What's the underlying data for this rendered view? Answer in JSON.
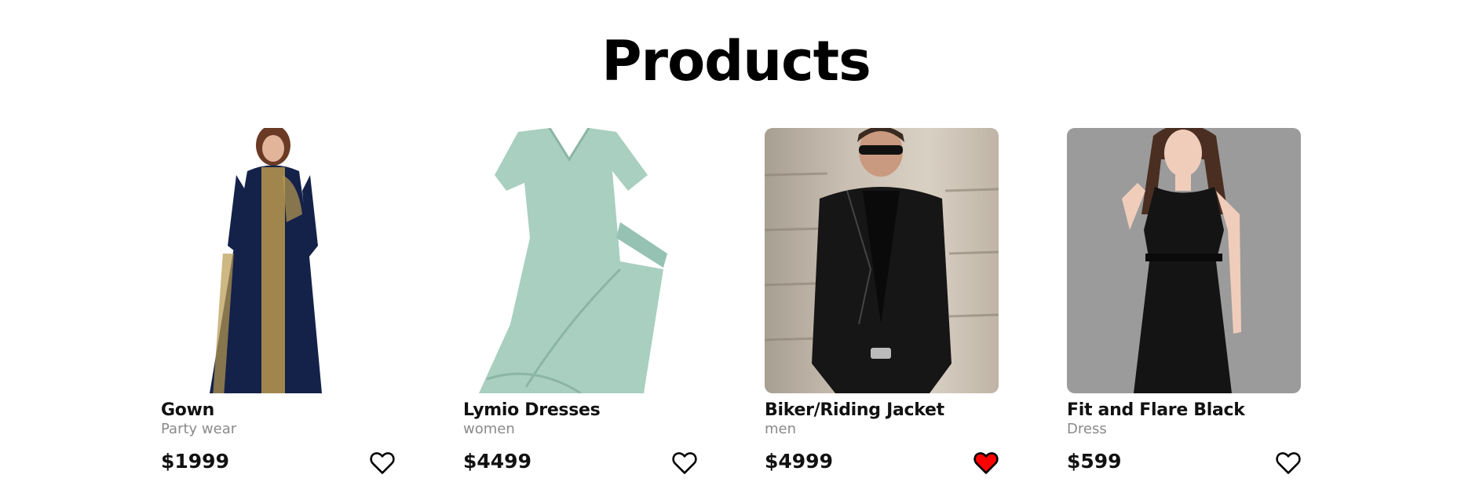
{
  "page": {
    "title": "Products"
  },
  "colors": {
    "favorite_active": "#ff0000",
    "category_text": "#8a8a8a"
  },
  "products": [
    {
      "name": "Gown",
      "category": "Party wear",
      "price": "$1999",
      "favorited": false,
      "image": "navy-gown-photo"
    },
    {
      "name": "Lymio Dresses",
      "category": "women",
      "price": "$4499",
      "favorited": false,
      "image": "mint-wrap-dress-photo"
    },
    {
      "name": "Biker/Riding Jacket",
      "category": "men",
      "price": "$4999",
      "favorited": true,
      "image": "leather-jacket-photo"
    },
    {
      "name": "Fit and Flare Black",
      "category": "Dress",
      "price": "$599",
      "favorited": false,
      "image": "black-dress-photo"
    }
  ]
}
